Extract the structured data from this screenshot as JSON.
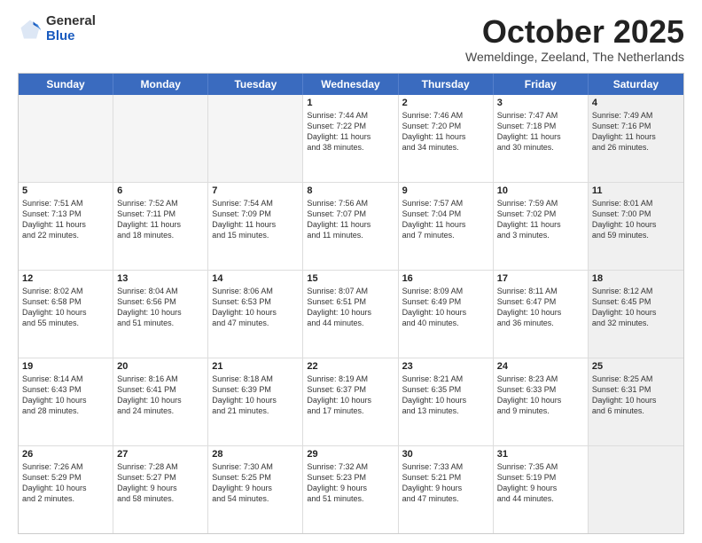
{
  "header": {
    "logo_general": "General",
    "logo_blue": "Blue",
    "month": "October 2025",
    "location": "Wemeldinge, Zeeland, The Netherlands"
  },
  "weekdays": [
    "Sunday",
    "Monday",
    "Tuesday",
    "Wednesday",
    "Thursday",
    "Friday",
    "Saturday"
  ],
  "rows": [
    [
      {
        "day": "",
        "text": "",
        "empty": true
      },
      {
        "day": "",
        "text": "",
        "empty": true
      },
      {
        "day": "",
        "text": "",
        "empty": true
      },
      {
        "day": "1",
        "text": "Sunrise: 7:44 AM\nSunset: 7:22 PM\nDaylight: 11 hours\nand 38 minutes."
      },
      {
        "day": "2",
        "text": "Sunrise: 7:46 AM\nSunset: 7:20 PM\nDaylight: 11 hours\nand 34 minutes."
      },
      {
        "day": "3",
        "text": "Sunrise: 7:47 AM\nSunset: 7:18 PM\nDaylight: 11 hours\nand 30 minutes."
      },
      {
        "day": "4",
        "text": "Sunrise: 7:49 AM\nSunset: 7:16 PM\nDaylight: 11 hours\nand 26 minutes.",
        "shaded": true
      }
    ],
    [
      {
        "day": "5",
        "text": "Sunrise: 7:51 AM\nSunset: 7:13 PM\nDaylight: 11 hours\nand 22 minutes."
      },
      {
        "day": "6",
        "text": "Sunrise: 7:52 AM\nSunset: 7:11 PM\nDaylight: 11 hours\nand 18 minutes."
      },
      {
        "day": "7",
        "text": "Sunrise: 7:54 AM\nSunset: 7:09 PM\nDaylight: 11 hours\nand 15 minutes."
      },
      {
        "day": "8",
        "text": "Sunrise: 7:56 AM\nSunset: 7:07 PM\nDaylight: 11 hours\nand 11 minutes."
      },
      {
        "day": "9",
        "text": "Sunrise: 7:57 AM\nSunset: 7:04 PM\nDaylight: 11 hours\nand 7 minutes."
      },
      {
        "day": "10",
        "text": "Sunrise: 7:59 AM\nSunset: 7:02 PM\nDaylight: 11 hours\nand 3 minutes."
      },
      {
        "day": "11",
        "text": "Sunrise: 8:01 AM\nSunset: 7:00 PM\nDaylight: 10 hours\nand 59 minutes.",
        "shaded": true
      }
    ],
    [
      {
        "day": "12",
        "text": "Sunrise: 8:02 AM\nSunset: 6:58 PM\nDaylight: 10 hours\nand 55 minutes."
      },
      {
        "day": "13",
        "text": "Sunrise: 8:04 AM\nSunset: 6:56 PM\nDaylight: 10 hours\nand 51 minutes."
      },
      {
        "day": "14",
        "text": "Sunrise: 8:06 AM\nSunset: 6:53 PM\nDaylight: 10 hours\nand 47 minutes."
      },
      {
        "day": "15",
        "text": "Sunrise: 8:07 AM\nSunset: 6:51 PM\nDaylight: 10 hours\nand 44 minutes."
      },
      {
        "day": "16",
        "text": "Sunrise: 8:09 AM\nSunset: 6:49 PM\nDaylight: 10 hours\nand 40 minutes."
      },
      {
        "day": "17",
        "text": "Sunrise: 8:11 AM\nSunset: 6:47 PM\nDaylight: 10 hours\nand 36 minutes."
      },
      {
        "day": "18",
        "text": "Sunrise: 8:12 AM\nSunset: 6:45 PM\nDaylight: 10 hours\nand 32 minutes.",
        "shaded": true
      }
    ],
    [
      {
        "day": "19",
        "text": "Sunrise: 8:14 AM\nSunset: 6:43 PM\nDaylight: 10 hours\nand 28 minutes."
      },
      {
        "day": "20",
        "text": "Sunrise: 8:16 AM\nSunset: 6:41 PM\nDaylight: 10 hours\nand 24 minutes."
      },
      {
        "day": "21",
        "text": "Sunrise: 8:18 AM\nSunset: 6:39 PM\nDaylight: 10 hours\nand 21 minutes."
      },
      {
        "day": "22",
        "text": "Sunrise: 8:19 AM\nSunset: 6:37 PM\nDaylight: 10 hours\nand 17 minutes."
      },
      {
        "day": "23",
        "text": "Sunrise: 8:21 AM\nSunset: 6:35 PM\nDaylight: 10 hours\nand 13 minutes."
      },
      {
        "day": "24",
        "text": "Sunrise: 8:23 AM\nSunset: 6:33 PM\nDaylight: 10 hours\nand 9 minutes."
      },
      {
        "day": "25",
        "text": "Sunrise: 8:25 AM\nSunset: 6:31 PM\nDaylight: 10 hours\nand 6 minutes.",
        "shaded": true
      }
    ],
    [
      {
        "day": "26",
        "text": "Sunrise: 7:26 AM\nSunset: 5:29 PM\nDaylight: 10 hours\nand 2 minutes."
      },
      {
        "day": "27",
        "text": "Sunrise: 7:28 AM\nSunset: 5:27 PM\nDaylight: 9 hours\nand 58 minutes."
      },
      {
        "day": "28",
        "text": "Sunrise: 7:30 AM\nSunset: 5:25 PM\nDaylight: 9 hours\nand 54 minutes."
      },
      {
        "day": "29",
        "text": "Sunrise: 7:32 AM\nSunset: 5:23 PM\nDaylight: 9 hours\nand 51 minutes."
      },
      {
        "day": "30",
        "text": "Sunrise: 7:33 AM\nSunset: 5:21 PM\nDaylight: 9 hours\nand 47 minutes."
      },
      {
        "day": "31",
        "text": "Sunrise: 7:35 AM\nSunset: 5:19 PM\nDaylight: 9 hours\nand 44 minutes."
      },
      {
        "day": "",
        "text": "",
        "empty": true,
        "shaded": true
      }
    ]
  ]
}
